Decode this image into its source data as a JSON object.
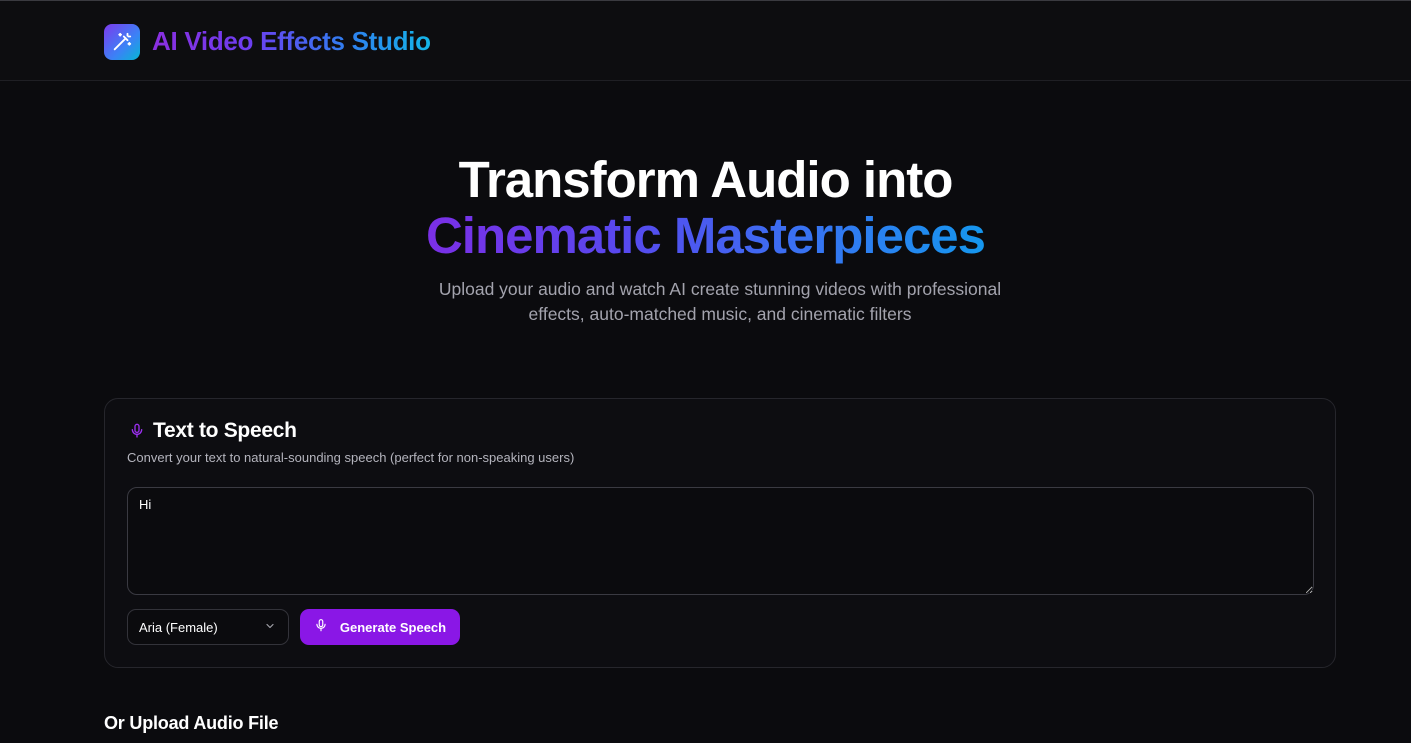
{
  "app": {
    "title": "AI Video Effects Studio",
    "logo_icon": "magic-wand-icon"
  },
  "hero": {
    "title_line1": "Transform Audio into",
    "title_line2": "Cinematic Masterpieces",
    "subtitle": "Upload your audio and watch AI create stunning videos with professional effects, auto-matched music, and cinematic filters"
  },
  "tts": {
    "icon": "microphone-icon",
    "title": "Text to Speech",
    "description": "Convert your text to natural-sounding speech (perfect for non-speaking users)",
    "text_value": "Hi",
    "voice_selected": "Aria (Female)",
    "generate_label": "Generate Speech"
  },
  "upload": {
    "label": "Or Upload Audio File"
  },
  "colors": {
    "accent": "#8a17e6",
    "background": "#0b0b0e",
    "gradient_start": "#7b2fe6",
    "gradient_end": "#1597ee"
  }
}
